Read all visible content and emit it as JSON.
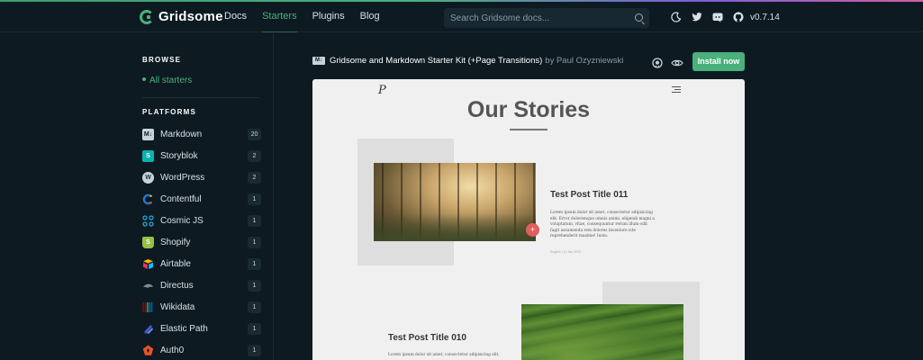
{
  "header": {
    "brand": "Gridsome",
    "nav": [
      {
        "label": "Docs",
        "active": false
      },
      {
        "label": "Starters",
        "active": true
      },
      {
        "label": "Plugins",
        "active": false
      },
      {
        "label": "Blog",
        "active": false
      }
    ],
    "search_placeholder": "Search Gridsome docs...",
    "icons": [
      "moon-icon",
      "twitter-icon",
      "discord-icon",
      "github-icon"
    ],
    "version": "v0.7.14"
  },
  "sidebar": {
    "browse_title": "BROWSE",
    "all_starters": "All starters",
    "platforms_title": "PLATFORMS",
    "platforms": [
      {
        "name": "Markdown",
        "count": "20",
        "icon": "markdown-icon",
        "color": "#c8d3d9"
      },
      {
        "name": "Storyblok",
        "count": "2",
        "icon": "storyblok-icon",
        "color": "#09b3af"
      },
      {
        "name": "WordPress",
        "count": "2",
        "icon": "wordpress-icon",
        "color": "#c8d3d9"
      },
      {
        "name": "Contentful",
        "count": "1",
        "icon": "contentful-icon",
        "color": "#2478cc"
      },
      {
        "name": "Cosmic JS",
        "count": "1",
        "icon": "cosmicjs-icon",
        "color": "#29abe2"
      },
      {
        "name": "Shopify",
        "count": "1",
        "icon": "shopify-icon",
        "color": "#95bf47"
      },
      {
        "name": "Airtable",
        "count": "1",
        "icon": "airtable-icon",
        "color": "#fcb400"
      },
      {
        "name": "Directus",
        "count": "1",
        "icon": "directus-icon",
        "color": "#7b8a93"
      },
      {
        "name": "Wikidata",
        "count": "1",
        "icon": "wikidata-icon",
        "color": "#990000"
      },
      {
        "name": "Elastic Path",
        "count": "1",
        "icon": "elasticpath-icon",
        "color": "#3b5ecc"
      },
      {
        "name": "Auth0",
        "count": "1",
        "icon": "auth0-icon",
        "color": "#eb5424"
      }
    ]
  },
  "starter": {
    "badge": "M↓",
    "title": "Gridsome and Markdown Starter Kit (+Page Transitions)",
    "by": "by Paul Ozyzniewski",
    "install_label": "Install now",
    "accent": "#4ab07c"
  },
  "preview": {
    "logo": "P",
    "heading": "Our Stories",
    "posts": [
      {
        "title": "Test Post Title 011",
        "excerpt": "Lorem ipsum dolor sit amet, consectetur adipisicing elit. Error doloremque omnis animi, eligendi magni a voluptatum, vitae, consequuntur rerum illum odit fugit assumenda rem dolores inventore iste reprehenderit maxime! Iusto.",
        "meta": "English | 11 Jan 2020",
        "plus": "+"
      },
      {
        "title": "Test Post Title 010",
        "excerpt": "Lorem ipsum dolor sit amet, consectetur adipisicing elit."
      }
    ]
  }
}
